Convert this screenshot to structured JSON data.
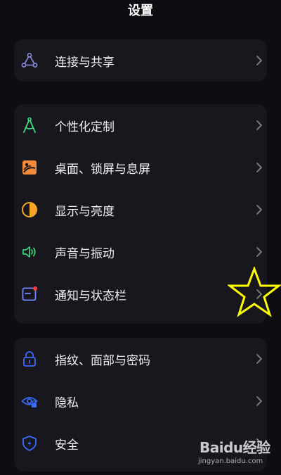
{
  "header": {
    "title": "设置"
  },
  "sections": [
    {
      "items": [
        {
          "label": "连接与共享",
          "icon": "connection-share-icon",
          "color": "#8a8fe0"
        }
      ]
    },
    {
      "items": [
        {
          "label": "个性化定制",
          "icon": "personalization-icon",
          "color": "#3ddc84"
        },
        {
          "label": "桌面、锁屏与息屏",
          "icon": "wallpaper-icon",
          "color": "#f58a3a"
        },
        {
          "label": "显示与亮度",
          "icon": "display-brightness-icon",
          "color": "#f5a623"
        },
        {
          "label": "声音与振动",
          "icon": "sound-vibration-icon",
          "color": "#3ddc84"
        },
        {
          "label": "通知与状态栏",
          "icon": "notification-icon",
          "color": "#7a8aff"
        }
      ]
    },
    {
      "items": [
        {
          "label": "指纹、面部与密码",
          "icon": "lock-icon",
          "color": "#3b6cff"
        },
        {
          "label": "隐私",
          "icon": "privacy-eye-icon",
          "color": "#3b6cff"
        },
        {
          "label": "安全",
          "icon": "security-shield-icon",
          "color": "#3b6cff"
        }
      ]
    }
  ],
  "annotation": {
    "icon": "star-annotation-icon",
    "color": "#ffff00"
  },
  "watermark": {
    "logo": "Baidu经验",
    "url": "jingyan.baidu.com"
  }
}
